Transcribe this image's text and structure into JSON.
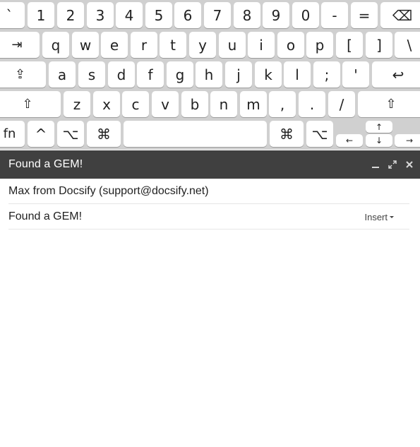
{
  "keyboard": {
    "row1": [
      "`",
      "1",
      "2",
      "3",
      "4",
      "5",
      "6",
      "7",
      "8",
      "9",
      "0",
      "-",
      "=",
      "⌫"
    ],
    "row2": [
      "⇥",
      "q",
      "w",
      "e",
      "r",
      "t",
      "y",
      "u",
      "i",
      "o",
      "p",
      "[",
      "]",
      "\\"
    ],
    "row3": [
      "⇪",
      "a",
      "s",
      "d",
      "f",
      "g",
      "h",
      "j",
      "k",
      "l",
      ";",
      "'",
      "↩"
    ],
    "row4": [
      "⇧",
      "z",
      "x",
      "c",
      "v",
      "b",
      "n",
      "m",
      ",",
      ".",
      "/",
      "⇧"
    ],
    "row5": [
      "fn",
      "^",
      "⌥",
      "⌘",
      "",
      "⌘",
      "⌥"
    ],
    "arrows": [
      "←",
      "↑",
      "↓",
      "→"
    ]
  },
  "compose": {
    "title": "Found a GEM!",
    "icons": [
      "minimize-icon",
      "expand-icon",
      "close-icon"
    ],
    "to": "Max from Docsify (support@docsify.net)",
    "subject": "Found a GEM!",
    "insert_label": "Insert",
    "body": ""
  }
}
